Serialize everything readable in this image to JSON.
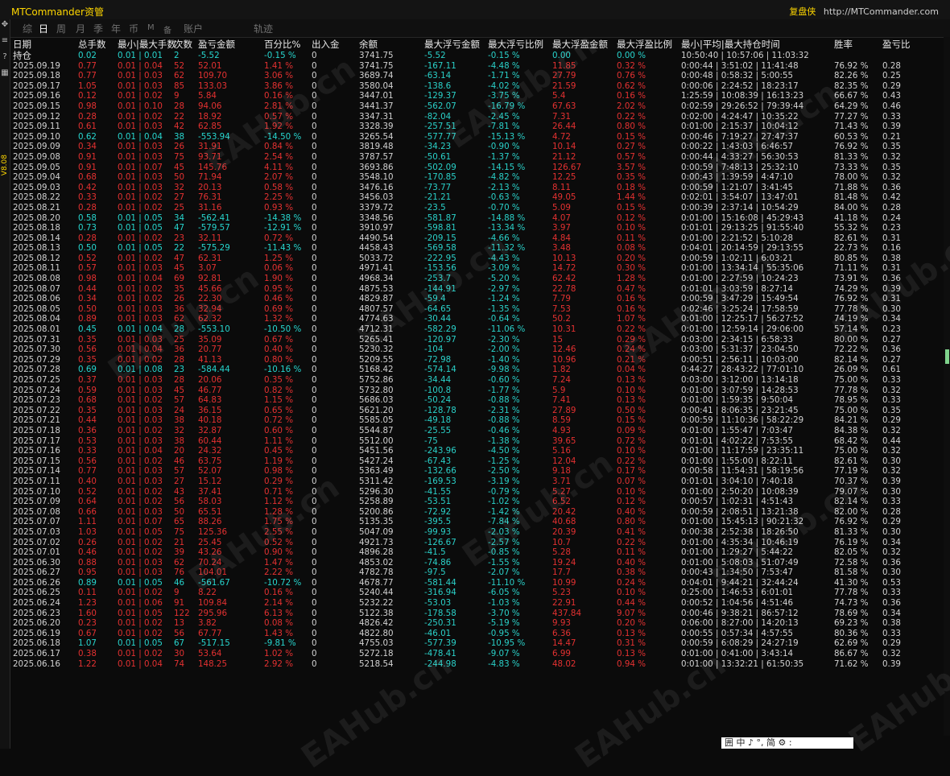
{
  "app": {
    "title": "MTCommander资管",
    "right_link": "复盘侠",
    "right_url": "http://MTCommander.com"
  },
  "tabs": [
    "综",
    "日",
    "周",
    "月",
    "季",
    "年",
    "币",
    "M",
    "备",
    "账户",
    "轨迹"
  ],
  "active_tab": "日",
  "version_label": "V8.08",
  "watermark_text": "EAHub.cn",
  "columns": [
    "日期",
    "总手数",
    "最小|最大手数",
    "次数",
    "盈亏金额",
    "百分比%",
    "出入金",
    "余额",
    "最大浮亏金额",
    "最大浮亏比例",
    "最大浮盈金额",
    "最大浮盈比例",
    "最小|平均|最大持仓时间",
    "胜率",
    "盈亏比"
  ],
  "holding_row": [
    "持仓",
    "0.02",
    "0.01 | 0.01",
    "2",
    "-5.52",
    "-0.15 %",
    "0",
    "3741.75",
    "-5.52",
    "-0.15 %",
    "0.00",
    "0.00 %",
    "10:50:40 | 10:57:06 | 11:03:32",
    "",
    ""
  ],
  "rows": [
    [
      "2025.09.19",
      "0.77",
      "0.01 | 0.04",
      "52",
      "52.01",
      "1.41 %",
      "0",
      "3741.75",
      "-167.11",
      "-4.48 %",
      "11.85",
      "0.32 %",
      "0:00:44 | 3:51:02 | 11:41:48",
      "76.92 %",
      "0.28"
    ],
    [
      "2025.09.18",
      "0.77",
      "0.01 | 0.03",
      "62",
      "109.70",
      "3.06 %",
      "0",
      "3689.74",
      "-63.14",
      "-1.71 %",
      "27.79",
      "0.76 %",
      "0:00:48 | 0:58:32 | 5:00:55",
      "82.26 %",
      "0.25"
    ],
    [
      "2025.09.17",
      "1.05",
      "0.01 | 0.03",
      "85",
      "133.03",
      "3.86 %",
      "0",
      "3580.04",
      "-138.6",
      "-4.02 %",
      "21.59",
      "0.62 %",
      "0:00:06 | 2:24:52 | 18:23:17",
      "82.35 %",
      "0.29"
    ],
    [
      "2025.09.16",
      "0.12",
      "0.01 | 0.02",
      "9",
      "5.84",
      "0.16 %",
      "0",
      "3447.01",
      "-129.37",
      "-3.75 %",
      "5.4",
      "0.16 %",
      "1:25:59 | 10:08:39 | 16:13:23",
      "66.67 %",
      "0.43"
    ],
    [
      "2025.09.15",
      "0.98",
      "0.01 | 0.10",
      "28",
      "94.06",
      "2.81 %",
      "0",
      "3441.37",
      "-562.07",
      "-16.79 %",
      "67.63",
      "2.02 %",
      "0:02:59 | 29:26:52 | 79:39:44",
      "64.29 %",
      "0.46"
    ],
    [
      "2025.09.12",
      "0.28",
      "0.01 | 0.02",
      "22",
      "18.92",
      "0.57 %",
      "0",
      "3347.31",
      "-82.04",
      "-2.45 %",
      "7.31",
      "0.22 %",
      "0:02:00 | 4:24:47 | 10:35:22",
      "77.27 %",
      "0.33"
    ],
    [
      "2025.09.11",
      "0.61",
      "0.01 | 0.03",
      "42",
      "62.85",
      "1.92 %",
      "0",
      "3328.39",
      "-257.51",
      "-7.81 %",
      "26.44",
      "0.80 %",
      "0:01:00 | 2:15:37 | 10:04:12",
      "71.43 %",
      "0.39"
    ],
    [
      "2025.09.10",
      "0.62",
      "0.01 | 0.04",
      "38",
      "-553.94",
      "-14.50 %",
      "0",
      "3265.54",
      "-577.77",
      "-15.13 %",
      "4.72",
      "0.15 %",
      "0:00:46 | 7:19:27 | 27:47:37",
      "60.53 %",
      "0.21"
    ],
    [
      "2025.09.09",
      "0.34",
      "0.01 | 0.03",
      "26",
      "31.91",
      "0.84 %",
      "0",
      "3819.48",
      "-34.23",
      "-0.90 %",
      "10.14",
      "0.27 %",
      "0:00:22 | 1:43:03 | 6:46:57",
      "76.92 %",
      "0.35"
    ],
    [
      "2025.09.08",
      "0.91",
      "0.01 | 0.03",
      "75",
      "93.71",
      "2.54 %",
      "0",
      "3787.57",
      "-50.61",
      "-1.37 %",
      "21.12",
      "0.57 %",
      "0:00:44 | 4:33:27 | 56:30:53",
      "81.33 %",
      "0.32"
    ],
    [
      "2025.09.05",
      "0.91",
      "0.01 | 0.07",
      "45",
      "145.76",
      "4.11 %",
      "0",
      "3693.86",
      "-502.09",
      "-14.15 %",
      "126.67",
      "3.57 %",
      "0:00:59 | 7:48:13 | 25:32:10",
      "73.33 %",
      "0.35"
    ],
    [
      "2025.09.04",
      "0.68",
      "0.01 | 0.03",
      "50",
      "71.94",
      "2.07 %",
      "0",
      "3548.10",
      "-170.85",
      "-4.82 %",
      "12.25",
      "0.35 %",
      "0:00:43 | 1:39:59 | 4:47:10",
      "78.00 %",
      "0.32"
    ],
    [
      "2025.09.03",
      "0.42",
      "0.01 | 0.03",
      "32",
      "20.13",
      "0.58 %",
      "0",
      "3476.16",
      "-73.77",
      "-2.13 %",
      "8.11",
      "0.18 %",
      "0:00:59 | 1:21:07 | 3:41:45",
      "71.88 %",
      "0.36"
    ],
    [
      "2025.08.22",
      "0.33",
      "0.01 | 0.02",
      "27",
      "76.31",
      "2.25 %",
      "0",
      "3456.03",
      "-21.21",
      "-0.63 %",
      "49.05",
      "1.44 %",
      "0:02:01 | 3:54:07 | 13:47:01",
      "81.48 %",
      "0.42"
    ],
    [
      "2025.08.21",
      "0.28",
      "0.01 | 0.02",
      "25",
      "31.16",
      "0.93 %",
      "0",
      "3379.72",
      "-23.5",
      "-0.70 %",
      "5.09",
      "0.15 %",
      "0:00:39 | 2:37:14 | 10:54:29",
      "84.00 %",
      "0.28"
    ],
    [
      "2025.08.20",
      "0.58",
      "0.01 | 0.05",
      "34",
      "-562.41",
      "-14.38 %",
      "0",
      "3348.56",
      "-581.87",
      "-14.88 %",
      "4.07",
      "0.12 %",
      "0:01:00 | 15:16:08 | 45:29:43",
      "41.18 %",
      "0.24"
    ],
    [
      "2025.08.18",
      "0.73",
      "0.01 | 0.05",
      "47",
      "-579.57",
      "-12.91 %",
      "0",
      "3910.97",
      "-598.81",
      "-13.34 %",
      "3.97",
      "0.10 %",
      "0:01:01 | 29:13:25 | 91:55:40",
      "55.32 %",
      "0.23"
    ],
    [
      "2025.08.14",
      "0.28",
      "0.01 | 0.02",
      "23",
      "32.11",
      "0.72 %",
      "0",
      "4490.54",
      "-209.15",
      "-4.66 %",
      "4.84",
      "0.11 %",
      "0:01:00 | 2:21:52 | 5:10:28",
      "82.61 %",
      "0.31"
    ],
    [
      "2025.08.13",
      "0.50",
      "0.01 | 0.05",
      "22",
      "-575.29",
      "-11.43 %",
      "0",
      "4458.43",
      "-569.58",
      "-11.32 %",
      "3.48",
      "0.08 %",
      "0:04:01 | 20:14:59 | 29:13:55",
      "22.73 %",
      "0.16"
    ],
    [
      "2025.08.12",
      "0.52",
      "0.01 | 0.02",
      "47",
      "62.31",
      "1.25 %",
      "0",
      "5033.72",
      "-222.95",
      "-4.43 %",
      "10.13",
      "0.20 %",
      "0:00:59 | 1:02:11 | 6:03:21",
      "80.85 %",
      "0.38"
    ],
    [
      "2025.08.11",
      "0.57",
      "0.01 | 0.03",
      "45",
      "3.07",
      "0.06 %",
      "0",
      "4971.41",
      "-153.56",
      "-3.09 %",
      "14.72",
      "0.30 %",
      "0:01:00 | 13:34:14 | 55:35:06",
      "71.11 %",
      "0.31"
    ],
    [
      "2025.08.08",
      "0.98",
      "0.01 | 0.04",
      "69",
      "92.81",
      "1.90 %",
      "0",
      "4968.34",
      "-253.7",
      "-5.20 %",
      "62.42",
      "1.28 %",
      "0:01:00 | 2:27:59 | 10:24:23",
      "73.91 %",
      "0.36"
    ],
    [
      "2025.08.07",
      "0.44",
      "0.01 | 0.02",
      "35",
      "45.66",
      "0.95 %",
      "0",
      "4875.53",
      "-144.91",
      "-2.97 %",
      "22.78",
      "0.47 %",
      "0:01:01 | 3:03:59 | 8:27:14",
      "74.29 %",
      "0.39"
    ],
    [
      "2025.08.06",
      "0.34",
      "0.01 | 0.02",
      "26",
      "22.30",
      "0.46 %",
      "0",
      "4829.87",
      "-59.4",
      "-1.24 %",
      "7.79",
      "0.16 %",
      "0:00:59 | 3:47:29 | 15:49:54",
      "76.92 %",
      "0.31"
    ],
    [
      "2025.08.05",
      "0.50",
      "0.01 | 0.03",
      "36",
      "32.94",
      "0.69 %",
      "0",
      "4807.57",
      "-64.65",
      "-1.35 %",
      "7.53",
      "0.16 %",
      "0:02:46 | 3:25:24 | 17:58:59",
      "77.78 %",
      "0.30"
    ],
    [
      "2025.08.04",
      "0.89",
      "0.01 | 0.03",
      "62",
      "62.32",
      "1.32 %",
      "0",
      "4774.63",
      "-30.44",
      "-0.64 %",
      "50.2",
      "1.07 %",
      "0:01:00 | 12:25:17 | 56:27:52",
      "74.19 %",
      "0.34"
    ],
    [
      "2025.08.01",
      "0.45",
      "0.01 | 0.04",
      "28",
      "-553.10",
      "-10.50 %",
      "0",
      "4712.31",
      "-582.29",
      "-11.06 %",
      "10.31",
      "0.22 %",
      "0:01:00 | 12:59:14 | 29:06:00",
      "57.14 %",
      "0.23"
    ],
    [
      "2025.07.31",
      "0.35",
      "0.01 | 0.03",
      "25",
      "35.09",
      "0.67 %",
      "0",
      "5265.41",
      "-120.97",
      "-2.30 %",
      "15",
      "0.29 %",
      "0:03:00 | 2:34:15 | 6:58:33",
      "80.00 %",
      "0.27"
    ],
    [
      "2025.07.30",
      "0.56",
      "0.01 | 0.04",
      "36",
      "20.77",
      "0.40 %",
      "0",
      "5230.32",
      "-104",
      "-2.00 %",
      "12.46",
      "0.24 %",
      "0:03:00 | 5:31:37 | 23:04:50",
      "72.22 %",
      "0.36"
    ],
    [
      "2025.07.29",
      "0.35",
      "0.01 | 0.02",
      "28",
      "41.13",
      "0.80 %",
      "0",
      "5209.55",
      "-72.98",
      "-1.40 %",
      "10.96",
      "0.21 %",
      "0:00:51 | 2:56:11 | 10:03:00",
      "82.14 %",
      "0.27"
    ],
    [
      "2025.07.28",
      "0.69",
      "0.01 | 0.08",
      "23",
      "-584.44",
      "-10.16 %",
      "0",
      "5168.42",
      "-574.14",
      "-9.98 %",
      "1.82",
      "0.04 %",
      "0:44:27 | 28:43:22 | 77:01:10",
      "26.09 %",
      "0.61"
    ],
    [
      "2025.07.25",
      "0.37",
      "0.01 | 0.03",
      "28",
      "20.06",
      "0.35 %",
      "0",
      "5752.86",
      "-34.44",
      "-0.60 %",
      "7.24",
      "0.13 %",
      "0:03:00 | 3:12:00 | 13:14:18",
      "75.00 %",
      "0.33"
    ],
    [
      "2025.07.24",
      "0.59",
      "0.01 | 0.03",
      "45",
      "46.77",
      "0.82 %",
      "0",
      "5732.80",
      "-100.8",
      "-1.77 %",
      "5.9",
      "0.10 %",
      "0:01:00 | 3:07:59 | 14:28:53",
      "77.78 %",
      "0.32"
    ],
    [
      "2025.07.23",
      "0.68",
      "0.01 | 0.02",
      "57",
      "64.83",
      "1.15 %",
      "0",
      "5686.03",
      "-50.24",
      "-0.88 %",
      "7.41",
      "0.13 %",
      "0:01:00 | 1:59:35 | 9:50:04",
      "78.95 %",
      "0.33"
    ],
    [
      "2025.07.22",
      "0.35",
      "0.01 | 0.03",
      "24",
      "36.15",
      "0.65 %",
      "0",
      "5621.20",
      "-128.78",
      "-2.31 %",
      "27.89",
      "0.50 %",
      "0:00:41 | 8:06:35 | 23:21:45",
      "75.00 %",
      "0.35"
    ],
    [
      "2025.07.21",
      "0.44",
      "0.01 | 0.03",
      "38",
      "40.18",
      "0.72 %",
      "0",
      "5585.05",
      "-49.18",
      "-0.88 %",
      "8.59",
      "0.15 %",
      "0:00:59 | 11:10:36 | 58:22:29",
      "84.21 %",
      "0.29"
    ],
    [
      "2025.07.18",
      "0.36",
      "0.01 | 0.02",
      "32",
      "32.87",
      "0.60 %",
      "0",
      "5544.87",
      "-25.55",
      "-0.46 %",
      "4.93",
      "0.09 %",
      "0:01:00 | 1:55:47 | 7:03:47",
      "84.38 %",
      "0.32"
    ],
    [
      "2025.07.17",
      "0.53",
      "0.01 | 0.03",
      "38",
      "60.44",
      "1.11 %",
      "0",
      "5512.00",
      "-75",
      "-1.38 %",
      "39.65",
      "0.72 %",
      "0:01:01 | 4:02:22 | 7:53:55",
      "68.42 %",
      "0.44"
    ],
    [
      "2025.07.16",
      "0.33",
      "0.01 | 0.04",
      "20",
      "24.32",
      "0.45 %",
      "0",
      "5451.56",
      "-243.96",
      "-4.50 %",
      "5.16",
      "0.10 %",
      "0:01:00 | 11:17:59 | 23:35:11",
      "75.00 %",
      "0.32"
    ],
    [
      "2025.07.15",
      "0.56",
      "0.01 | 0.02",
      "46",
      "63.75",
      "1.19 %",
      "0",
      "5427.24",
      "-67.43",
      "-1.25 %",
      "12.04",
      "0.22 %",
      "0:01:00 | 1:55:00 | 8:22:11",
      "82.61 %",
      "0.30"
    ],
    [
      "2025.07.14",
      "0.77",
      "0.01 | 0.03",
      "57",
      "52.07",
      "0.98 %",
      "0",
      "5363.49",
      "-132.66",
      "-2.50 %",
      "9.18",
      "0.17 %",
      "0:00:58 | 11:54:31 | 58:19:56",
      "77.19 %",
      "0.32"
    ],
    [
      "2025.07.11",
      "0.40",
      "0.01 | 0.03",
      "27",
      "15.12",
      "0.29 %",
      "0",
      "5311.42",
      "-169.53",
      "-3.19 %",
      "3.71",
      "0.07 %",
      "0:01:01 | 3:04:10 | 7:40:18",
      "70.37 %",
      "0.39"
    ],
    [
      "2025.07.10",
      "0.52",
      "0.01 | 0.02",
      "43",
      "37.41",
      "0.71 %",
      "0",
      "5296.30",
      "-41.55",
      "-0.79 %",
      "5.27",
      "0.10 %",
      "0:01:00 | 2:50:20 | 10:08:39",
      "79.07 %",
      "0.30"
    ],
    [
      "2025.07.09",
      "0.64",
      "0.01 | 0.02",
      "56",
      "58.03",
      "1.12 %",
      "0",
      "5258.89",
      "-53.51",
      "-1.02 %",
      "6.52",
      "0.12 %",
      "0:00:57 | 1:02:31 | 4:51:43",
      "82.14 %",
      "0.33"
    ],
    [
      "2025.07.08",
      "0.66",
      "0.01 | 0.03",
      "50",
      "65.51",
      "1.28 %",
      "0",
      "5200.86",
      "-72.92",
      "-1.42 %",
      "20.42",
      "0.40 %",
      "0:00:59 | 2:08:51 | 13:21:38",
      "82.00 %",
      "0.28"
    ],
    [
      "2025.07.07",
      "1.11",
      "0.01 | 0.07",
      "65",
      "88.26",
      "1.75 %",
      "0",
      "5135.35",
      "-395.5",
      "-7.84 %",
      "40.68",
      "0.80 %",
      "0:01:00 | 15:45:13 | 90:21:32",
      "76.92 %",
      "0.29"
    ],
    [
      "2025.07.03",
      "1.03",
      "0.01 | 0.05",
      "75",
      "125.36",
      "2.55 %",
      "0",
      "5047.09",
      "-99.93",
      "-2.03 %",
      "20.39",
      "0.41 %",
      "0:00:38 | 2:52:38 | 18:26:50",
      "81.33 %",
      "0.30"
    ],
    [
      "2025.07.02",
      "0.26",
      "0.01 | 0.02",
      "21",
      "25.45",
      "0.52 %",
      "0",
      "4921.73",
      "-126.67",
      "-2.57 %",
      "10.7",
      "0.22 %",
      "0:01:00 | 4:35:34 | 10:46:19",
      "76.19 %",
      "0.34"
    ],
    [
      "2025.07.01",
      "0.46",
      "0.01 | 0.02",
      "39",
      "43.26",
      "0.90 %",
      "0",
      "4896.28",
      "-41.5",
      "-0.85 %",
      "5.28",
      "0.11 %",
      "0:01:00 | 1:29:27 | 5:44:22",
      "82.05 %",
      "0.32"
    ],
    [
      "2025.06.30",
      "0.88",
      "0.01 | 0.03",
      "62",
      "70.24",
      "1.47 %",
      "0",
      "4853.02",
      "-74.86",
      "-1.55 %",
      "19.24",
      "0.40 %",
      "0:01:00 | 5:08:03 | 51:07:49",
      "72.58 %",
      "0.36"
    ],
    [
      "2025.06.27",
      "0.95",
      "0.01 | 0.03",
      "76",
      "104.01",
      "2.22 %",
      "0",
      "4782.78",
      "-97.5",
      "-2.07 %",
      "17.7",
      "0.38 %",
      "0:00:43 | 1:34:50 | 7:53:47",
      "81.58 %",
      "0.30"
    ],
    [
      "2025.06.26",
      "0.89",
      "0.01 | 0.05",
      "46",
      "-561.67",
      "-10.72 %",
      "0",
      "4678.77",
      "-581.44",
      "-11.10 %",
      "10.99",
      "0.24 %",
      "0:04:01 | 9:44:21 | 32:44:24",
      "41.30 %",
      "0.53"
    ],
    [
      "2025.06.25",
      "0.11",
      "0.01 | 0.02",
      "9",
      "8.22",
      "0.16 %",
      "0",
      "5240.44",
      "-316.94",
      "-6.05 %",
      "5.23",
      "0.10 %",
      "0:25:00 | 1:46:53 | 6:01:01",
      "77.78 %",
      "0.33"
    ],
    [
      "2025.06.24",
      "1.23",
      "0.01 | 0.06",
      "91",
      "109.84",
      "2.14 %",
      "0",
      "5232.22",
      "-53.03",
      "-1.03 %",
      "22.91",
      "0.44 %",
      "0:00:52 | 1:04:56 | 4:51:46",
      "74.73 %",
      "0.36"
    ],
    [
      "2025.06.23",
      "1.60",
      "0.01 | 0.05",
      "122",
      "295.96",
      "6.13 %",
      "0",
      "5122.38",
      "-178.58",
      "-3.70 %",
      "437.84",
      "9.07 %",
      "0:00:46 | 9:38:21 | 86:57:12",
      "78.69 %",
      "0.34"
    ],
    [
      "2025.06.20",
      "0.23",
      "0.01 | 0.02",
      "13",
      "3.82",
      "0.08 %",
      "0",
      "4826.42",
      "-250.31",
      "-5.19 %",
      "9.93",
      "0.20 %",
      "0:06:00 | 8:27:00 | 14:20:13",
      "69.23 %",
      "0.38"
    ],
    [
      "2025.06.19",
      "0.67",
      "0.01 | 0.02",
      "56",
      "67.77",
      "1.43 %",
      "0",
      "4822.80",
      "-46.01",
      "-0.95 %",
      "6.36",
      "0.13 %",
      "0:00:55 | 0:57:34 | 4:57:55",
      "80.36 %",
      "0.33"
    ],
    [
      "2025.06.18",
      "1.07",
      "0.01 | 0.05",
      "67",
      "-517.15",
      "-9.81 %",
      "0",
      "4755.03",
      "-577.39",
      "-10.95 %",
      "14.47",
      "0.31 %",
      "0:00:59 | 6:08:29 | 24:27:19",
      "62.69 %",
      "0.29"
    ],
    [
      "2025.06.17",
      "0.38",
      "0.01 | 0.02",
      "30",
      "53.64",
      "1.02 %",
      "0",
      "5272.18",
      "-478.41",
      "-9.07 %",
      "6.99",
      "0.13 %",
      "0:01:00 | 0:41:00 | 3:43:14",
      "86.67 %",
      "0.32"
    ],
    [
      "2025.06.16",
      "1.22",
      "0.01 | 0.04",
      "74",
      "148.25",
      "2.92 %",
      "0",
      "5218.54",
      "-244.98",
      "-4.83 %",
      "48.02",
      "0.94 %",
      "0:01:00 | 13:32:21 | 61:50:35",
      "71.62 %",
      "0.39"
    ]
  ],
  "taskbar": "囲 中 ♪ °, 简 ⚙ :"
}
